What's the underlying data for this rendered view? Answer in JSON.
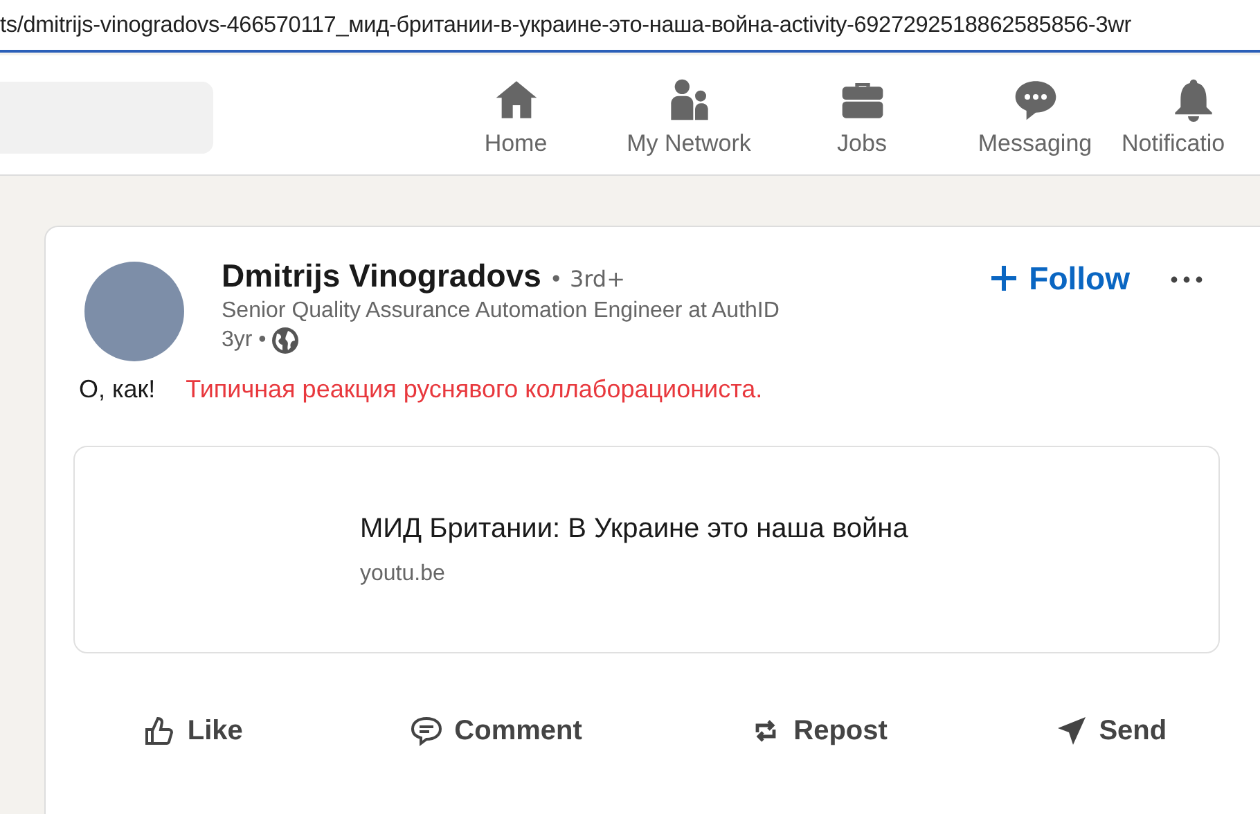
{
  "address_bar": {
    "url": "ts/dmitrijs-vinogradovs-466570117_мид-британии-в-украине-это-наша-война-activity-6927292518862585856-3wr"
  },
  "nav": {
    "items": [
      {
        "kind": "home",
        "label": "Home"
      },
      {
        "kind": "network",
        "label": "My Network"
      },
      {
        "kind": "jobs",
        "label": "Jobs"
      },
      {
        "kind": "messaging",
        "label": "Messaging"
      },
      {
        "kind": "notifications",
        "label": "Notificatio"
      }
    ]
  },
  "post": {
    "author": {
      "name": "Dmitrijs Vinogradovs",
      "degree": "• 3rd+",
      "headline": "Senior Quality Assurance Automation Engineer at AuthID",
      "time": "3yr •"
    },
    "follow_button": "Follow",
    "text": "О, как!",
    "annotation": "Типичная реакция руснявого коллаборациониста.",
    "link_preview": {
      "title": "МИД Британии: В Украине это наша война",
      "domain": "youtu.be"
    },
    "actions": [
      {
        "kind": "like",
        "label": "Like"
      },
      {
        "kind": "comment",
        "label": "Comment"
      },
      {
        "kind": "repost",
        "label": "Repost"
      },
      {
        "kind": "send",
        "label": "Send"
      }
    ]
  }
}
